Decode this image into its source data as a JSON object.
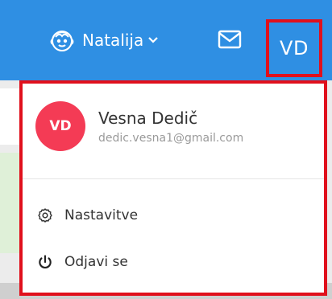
{
  "header": {
    "profile_name": "Natalija",
    "avatar_initials": "VD"
  },
  "dropdown": {
    "user_initials": "VD",
    "user_name": "Vesna Dedič",
    "user_email": "dedic.vesna1@gmail.com",
    "items": [
      {
        "label": "Nastavitve",
        "icon": "gear-icon"
      },
      {
        "label": "Odjavi se",
        "icon": "power-icon"
      }
    ]
  },
  "colors": {
    "topbar": "#2f8fe3",
    "highlight_border": "#e0101c",
    "avatar_bg": "#f43b55"
  }
}
